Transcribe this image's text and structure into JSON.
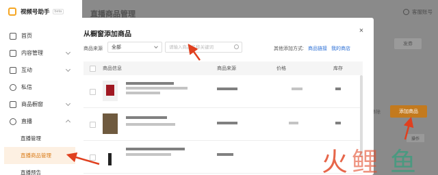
{
  "app": {
    "name": "视频号助手",
    "badge": "beta"
  },
  "sidebar": {
    "items": [
      {
        "label": "首页",
        "icon": "home-icon"
      },
      {
        "label": "内容管理",
        "icon": "camera-icon",
        "expandable": true
      },
      {
        "label": "互动",
        "icon": "chat-icon",
        "expandable": true
      },
      {
        "label": "私信",
        "icon": "message-icon"
      },
      {
        "label": "商品橱窗",
        "icon": "shop-icon",
        "expandable": true
      },
      {
        "label": "直播",
        "icon": "live-icon",
        "expanded": true
      }
    ],
    "sub_items": [
      {
        "label": "直播管理"
      },
      {
        "label": "直播商品管理",
        "active": true
      },
      {
        "label": "直播预告"
      }
    ]
  },
  "page": {
    "title": "直播商品管理",
    "account_label": "客服账号",
    "publish_label": "发券",
    "side_text": "移除",
    "add_goods_label": "添加商品",
    "op_label": "操作"
  },
  "modal": {
    "title": "从橱窗添加商品",
    "close": "×",
    "filter_label": "商品来源",
    "filter_value": "全部",
    "search_placeholder": "请输入商品名称关键词",
    "other_add_label": "其他添加方式:",
    "link_add": "商品链接",
    "link_shop": "我的商店",
    "columns": [
      "商品信息",
      "商品来源",
      "价格",
      "库存"
    ]
  },
  "watermark": {
    "chars": [
      "火",
      "鲤",
      "鱼"
    ]
  },
  "colors": {
    "accent": "#e8851a",
    "arrow": "#e0401f",
    "link": "#2b6fd6"
  }
}
